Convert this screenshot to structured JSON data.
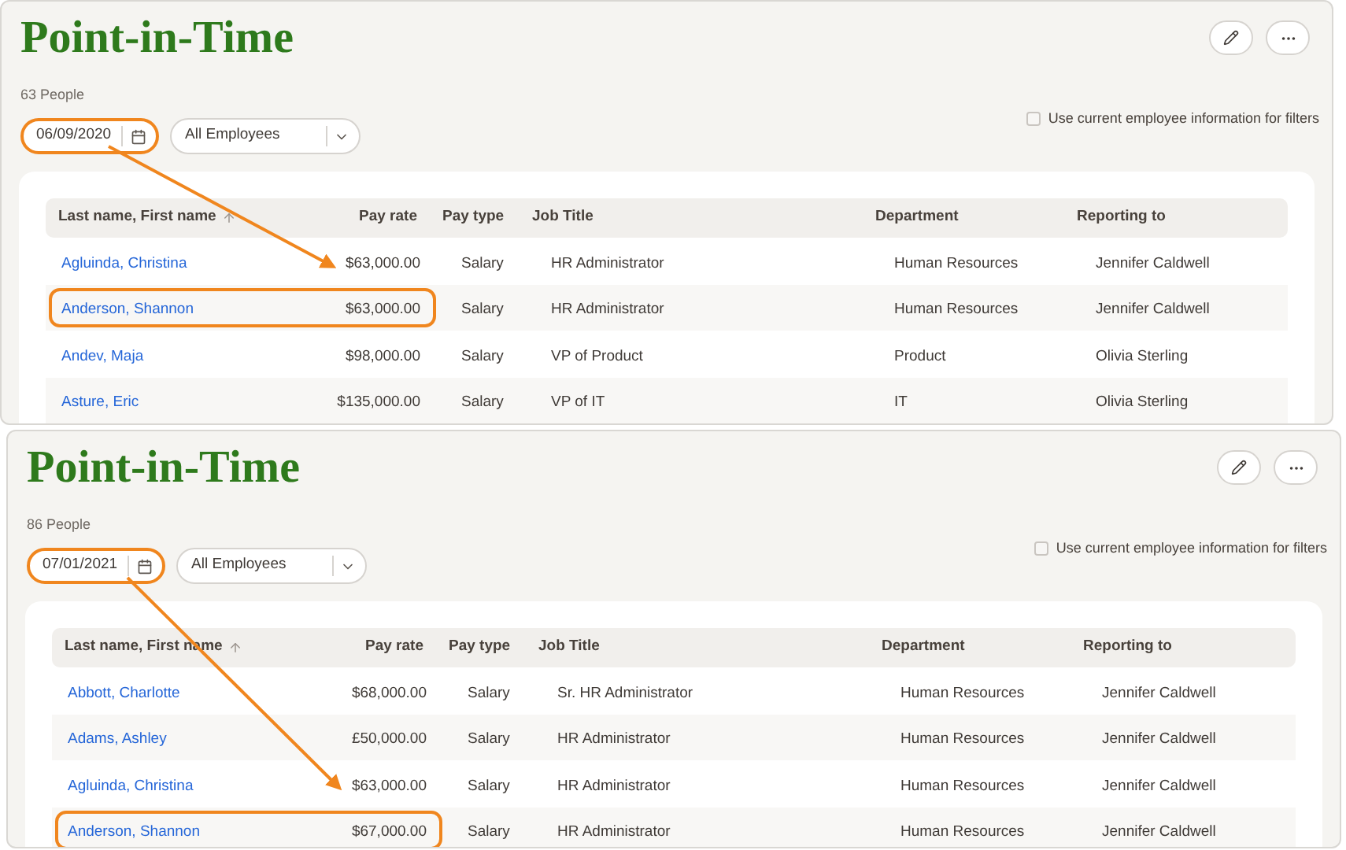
{
  "panels": [
    {
      "title": "Point-in-Time",
      "count": "63 People",
      "date": {
        "value": "06/09/2020",
        "highlighted": true
      },
      "filter": {
        "value": "All Employees"
      },
      "current_info": {
        "label": "Use current employee information for filters",
        "checked": false
      },
      "columns": [
        "Last name, First name",
        "Pay rate",
        "Pay type",
        "Job Title",
        "Department",
        "Reporting to"
      ],
      "rows": [
        {
          "cells": [
            "Agluinda, Christina",
            "$63,000.00",
            "Salary",
            "HR Administrator",
            "Human Resources",
            "Jennifer Caldwell"
          ],
          "highlighted": false
        },
        {
          "cells": [
            "Anderson, Shannon",
            "$63,000.00",
            "Salary",
            "HR Administrator",
            "Human Resources",
            "Jennifer Caldwell"
          ],
          "highlighted": true
        },
        {
          "cells": [
            "Andev, Maja",
            "$98,000.00",
            "Salary",
            "VP of Product",
            "Product",
            "Olivia Sterling"
          ],
          "highlighted": false
        },
        {
          "cells": [
            "Asture, Eric",
            "$135,000.00",
            "Salary",
            "VP of IT",
            "IT",
            "Olivia Sterling"
          ],
          "highlighted": false
        }
      ]
    },
    {
      "title": "Point-in-Time",
      "count": "86 People",
      "date": {
        "value": "07/01/2021",
        "highlighted": true
      },
      "filter": {
        "value": "All Employees"
      },
      "current_info": {
        "label": "Use current employee information for filters",
        "checked": false
      },
      "columns": [
        "Last name, First name",
        "Pay rate",
        "Pay type",
        "Job Title",
        "Department",
        "Reporting to"
      ],
      "rows": [
        {
          "cells": [
            "Abbott, Charlotte",
            "$68,000.00",
            "Salary",
            "Sr. HR Administrator",
            "Human Resources",
            "Jennifer Caldwell"
          ],
          "highlighted": false
        },
        {
          "cells": [
            "Adams, Ashley",
            "£50,000.00",
            "Salary",
            "HR Administrator",
            "Human Resources",
            "Jennifer Caldwell"
          ],
          "highlighted": false
        },
        {
          "cells": [
            "Agluinda, Christina",
            "$63,000.00",
            "Salary",
            "HR Administrator",
            "Human Resources",
            "Jennifer Caldwell"
          ],
          "highlighted": false
        },
        {
          "cells": [
            "Anderson, Shannon",
            "$67,000.00",
            "Salary",
            "HR Administrator",
            "Human Resources",
            "Jennifer Caldwell"
          ],
          "highlighted": true
        }
      ]
    }
  ]
}
